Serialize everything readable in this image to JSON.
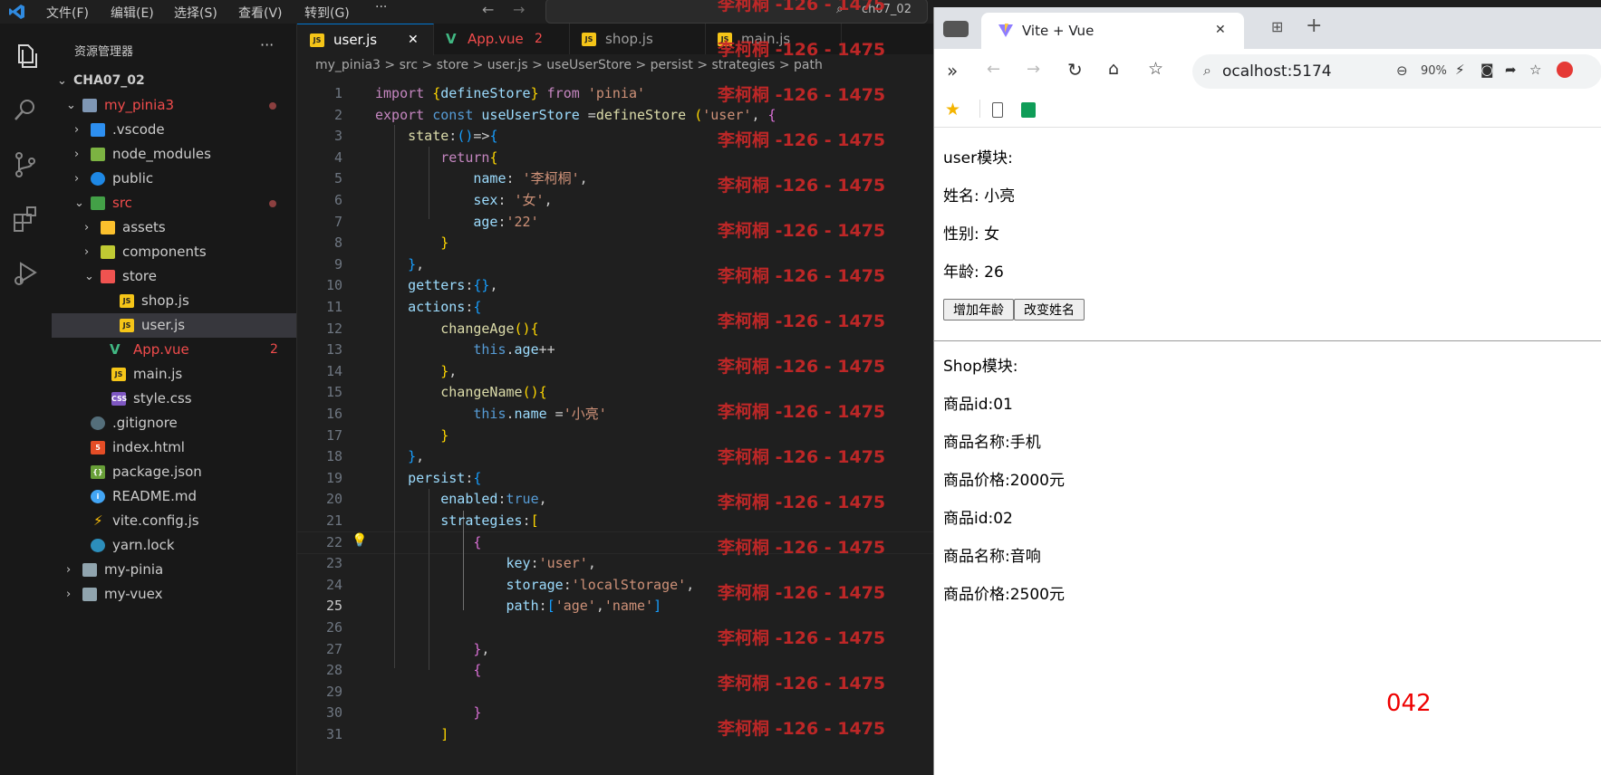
{
  "vscode": {
    "menu": [
      "文件(F)",
      "编辑(E)",
      "选择(S)",
      "查看(V)",
      "转到(G)",
      "···"
    ],
    "search_text": "ch07_02",
    "sidebar": {
      "title": "资源管理器",
      "more": "···",
      "root": "CHA07_02",
      "items": [
        {
          "label": "my_pinia3",
          "color": "#f14c4c"
        },
        {
          "label": ".vscode"
        },
        {
          "label": "node_modules"
        },
        {
          "label": "public"
        },
        {
          "label": "src",
          "color": "#f14c4c"
        },
        {
          "label": "assets"
        },
        {
          "label": "components"
        },
        {
          "label": "store"
        },
        {
          "label": "shop.js"
        },
        {
          "label": "user.js"
        },
        {
          "label": "App.vue",
          "badge": "2",
          "color": "#f14c4c"
        },
        {
          "label": "main.js"
        },
        {
          "label": "style.css"
        },
        {
          "label": ".gitignore"
        },
        {
          "label": "index.html"
        },
        {
          "label": "package.json"
        },
        {
          "label": "README.md"
        },
        {
          "label": "vite.config.js"
        },
        {
          "label": "yarn.lock"
        },
        {
          "label": "my-pinia"
        },
        {
          "label": "my-vuex"
        }
      ]
    },
    "tabs": [
      {
        "label": "user.js",
        "close": "✕"
      },
      {
        "label": "App.vue",
        "badge": "2"
      },
      {
        "label": "shop.js"
      },
      {
        "label": "main.js"
      }
    ],
    "breadcrumbs": [
      "my_pinia3",
      ">",
      "src",
      ">",
      "store",
      ">",
      "user.js",
      ">",
      "useUserStore",
      ">",
      "persist",
      ">",
      "strategies",
      ">",
      "path"
    ],
    "line_numbers": [
      "1",
      "2",
      "3",
      "4",
      "5",
      "6",
      "7",
      "8",
      "9",
      "10",
      "11",
      "12",
      "13",
      "14",
      "15",
      "16",
      "17",
      "18",
      "19",
      "20",
      "21",
      "22",
      "23",
      "24",
      "25",
      "26",
      "27",
      "28",
      "29",
      "30",
      "31"
    ],
    "current_line": "25",
    "watermark": "李柯桐 -126 - 1475"
  },
  "browser": {
    "tab_title": "Vite + Vue",
    "tab_close": "✕",
    "new_tab": "+",
    "address": "ocalhost:5174",
    "zoom": "90%",
    "page": {
      "user_heading": "user模块:",
      "name_line": "姓名: 小亮",
      "sex_line": "性别: 女",
      "age_line": "年龄: 26",
      "btn_add_age": "增加年龄",
      "btn_change_name": "改变姓名",
      "shop_heading": "Shop模块:",
      "items": [
        "商品id:01",
        "商品名称:手机",
        "商品价格:2000元",
        "商品id:02",
        "商品名称:音响",
        "商品价格:2500元"
      ],
      "stamp": "042"
    }
  }
}
